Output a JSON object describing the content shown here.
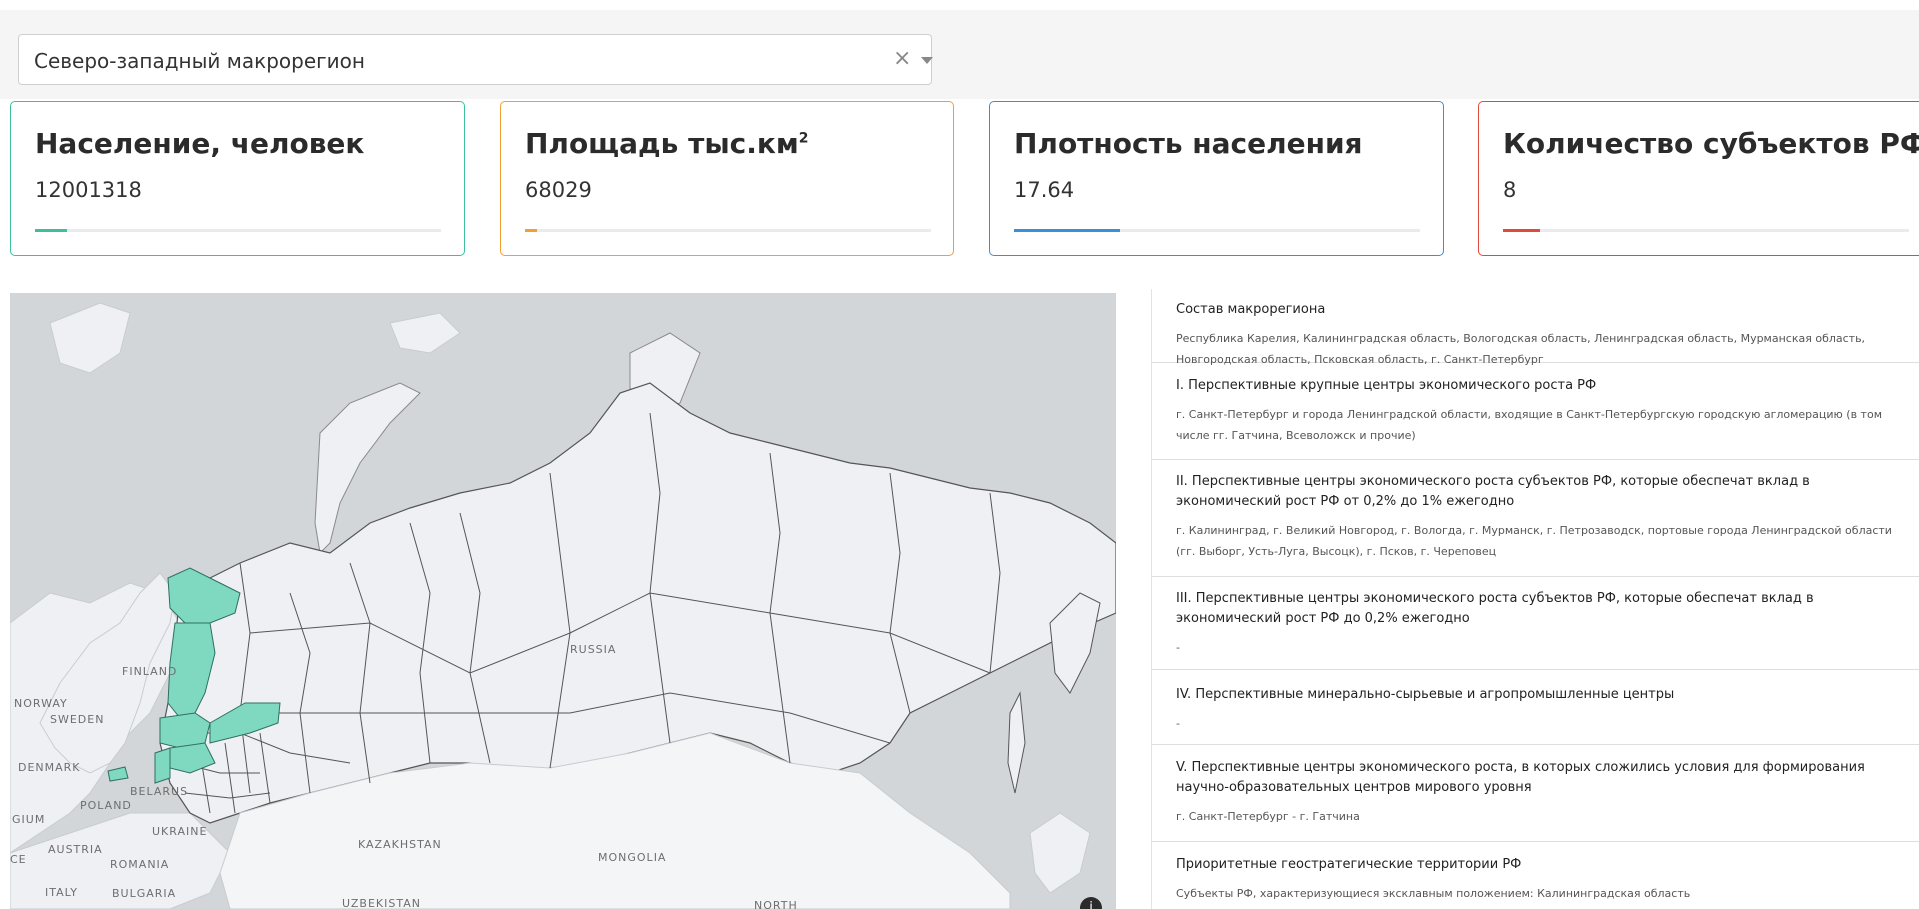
{
  "filter": {
    "selected": "Северо-западный макрорегион",
    "clear_glyph": "×"
  },
  "kpis": [
    {
      "title": "Население, человек",
      "value": "12001318",
      "color": "#3dbf9c",
      "progress": 0.08
    },
    {
      "title": "Площадь тыс.км",
      "title_sup": "2",
      "value": "68029",
      "color": "#f0a030",
      "progress": 0.03
    },
    {
      "title": "Плотность населения",
      "value": "17.64",
      "color": "#3a8fd8",
      "progress": 0.26
    },
    {
      "title": "Количество субъектов РФ",
      "value": "8",
      "color": "#e04a3a",
      "progress": 0.09
    }
  ],
  "map": {
    "labels": {
      "russia": "RUSSIA",
      "finland": "FINLAND",
      "norway": "NORWAY",
      "sweden": "SWEDEN",
      "denmark": "DENMARK",
      "poland": "POLAND",
      "belarus": "BELARUS",
      "ukraine": "UKRAINE",
      "austria": "AUSTRIA",
      "romania": "ROMANIA",
      "gium": "GIUM",
      "italy": "ITALY",
      "bulgaria": "BULGARIA",
      "kazakhstan": "KAZAKHSTAN",
      "mongolia": "MONGOLIA",
      "uzbekistan": "UZBEKISTAN",
      "north": "NORTH",
      "ce": "CE"
    },
    "highlight_color": "#7fd8c0",
    "land_color": "#eef0f4",
    "water_color": "#d3d6d8",
    "info_glyph": "i"
  },
  "info": [
    {
      "title": "Состав макрорегиона",
      "body": "Республика Карелия, Калининградская область, Вологодская область, Ленинградская область, Мурманская область, Новгородская область, Псковская область, г. Санкт-Петербург"
    },
    {
      "title": "I. Перспективные крупные центры экономического роста РФ",
      "body": "г. Санкт-Петербург и города Ленинградской области, входящие в Санкт-Петербургскую городскую агломерацию (в том числе гг. Гатчина, Всеволожск и прочие)"
    },
    {
      "title": "II. Перспективные центры экономического роста субъектов РФ, которые обеспечат вклад в экономический рост РФ от 0,2% до 1% ежегодно",
      "body": "г. Калининград, г. Великий Новгород, г. Вологда, г. Мурманск, г. Петрозаводск, портовые города Ленинградской области (гг. Выборг, Усть-Луга, Высоцк), г. Псков, г. Череповец"
    },
    {
      "title": "III. Перспективные центры экономического роста субъектов РФ, которые обеспечат вклад в экономический рост РФ до 0,2% ежегодно",
      "body": "-"
    },
    {
      "title": "IV. Перспективные минерально-сырьевые и агропромышленные центры",
      "body": "-"
    },
    {
      "title": "V. Перспективные центры экономического роста, в которых сложились условия для формирования научно-образовательных центров мирового уровня",
      "body": "г. Санкт-Петербург - г. Гатчина"
    },
    {
      "title": "Приоритетные геостратегические территории РФ",
      "body": "Субъекты РФ, характеризующиеся эксклавным положением: Калининградская область"
    }
  ]
}
